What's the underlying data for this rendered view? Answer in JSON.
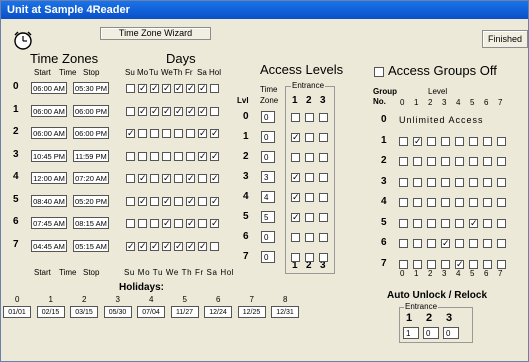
{
  "window": {
    "title": "Unit at Sample 4Reader"
  },
  "toolbar": {
    "wizard_label": "Time Zone Wizard",
    "finished_label": "Finished"
  },
  "timezones": {
    "heading": "Time Zones",
    "days_heading": "Days",
    "col_start": "Start",
    "col_time": "Time",
    "col_stop": "Stop",
    "day_labels": [
      "Su",
      "Mo",
      "Tu",
      "We",
      "Th",
      "Fr",
      "Sa",
      "Hol"
    ],
    "rows": [
      {
        "num": "0",
        "start": "06:00 AM",
        "stop": "05:30 PM",
        "days": [
          0,
          1,
          1,
          1,
          1,
          1,
          1,
          0
        ]
      },
      {
        "num": "1",
        "start": "06:00 AM",
        "stop": "06:00 PM",
        "days": [
          0,
          1,
          1,
          1,
          1,
          1,
          1,
          0
        ]
      },
      {
        "num": "2",
        "start": "06:00 AM",
        "stop": "06:00 PM",
        "days": [
          1,
          0,
          0,
          0,
          0,
          0,
          1,
          1
        ]
      },
      {
        "num": "3",
        "start": "10:45 PM",
        "stop": "11:59 PM",
        "days": [
          0,
          0,
          0,
          0,
          0,
          0,
          1,
          1
        ]
      },
      {
        "num": "4",
        "start": "12:00 AM",
        "stop": "07:20 AM",
        "days": [
          0,
          1,
          0,
          1,
          0,
          1,
          0,
          1
        ]
      },
      {
        "num": "5",
        "start": "08:40 AM",
        "stop": "05:20 PM",
        "days": [
          0,
          1,
          0,
          1,
          0,
          1,
          0,
          1
        ]
      },
      {
        "num": "6",
        "start": "07:45 AM",
        "stop": "08:15 AM",
        "days": [
          0,
          0,
          0,
          1,
          0,
          1,
          0,
          1
        ]
      },
      {
        "num": "7",
        "start": "04:45 AM",
        "stop": "05:15 AM",
        "days": [
          1,
          1,
          1,
          1,
          1,
          1,
          1,
          0
        ]
      }
    ],
    "footer_start": "Start",
    "footer_time": "Time",
    "footer_stop": "Stop",
    "footer_days": "Su Mo Tu We Th Fr Sa Hol"
  },
  "holidays": {
    "heading": "Holidays:",
    "indexes": [
      "0",
      "1",
      "2",
      "3",
      "4",
      "5",
      "6",
      "7",
      "8"
    ],
    "dates": [
      "01/01",
      "02/15",
      "03/15",
      "05/30",
      "07/04",
      "11/27",
      "12/24",
      "12/25",
      "12/31"
    ]
  },
  "access_levels": {
    "heading": "Access Levels",
    "time_zone_label_1": "Time",
    "time_zone_label_2": "Zone",
    "lvl_label": "Lvl",
    "entrance_label": "Entrance",
    "entrance_nums": [
      "1",
      "2",
      "3"
    ],
    "rows": [
      {
        "lvl": "0",
        "tz": "0",
        "ent": [
          0,
          0,
          0
        ]
      },
      {
        "lvl": "1",
        "tz": "0",
        "ent": [
          1,
          0,
          0
        ]
      },
      {
        "lvl": "2",
        "tz": "0",
        "ent": [
          0,
          0,
          0
        ]
      },
      {
        "lvl": "3",
        "tz": "3",
        "ent": [
          1,
          0,
          0
        ]
      },
      {
        "lvl": "4",
        "tz": "4",
        "ent": [
          1,
          0,
          0
        ]
      },
      {
        "lvl": "5",
        "tz": "5",
        "ent": [
          1,
          0,
          0
        ]
      },
      {
        "lvl": "6",
        "tz": "0",
        "ent": [
          0,
          0,
          0
        ]
      },
      {
        "lvl": "7",
        "tz": "0",
        "ent": [
          0,
          0,
          0
        ]
      }
    ]
  },
  "access_groups": {
    "toggle_label": "Access Groups Off",
    "group_label_1": "Group",
    "group_label_2": "No.",
    "level_label": "Level",
    "level_nums": [
      "0",
      "1",
      "2",
      "3",
      "4",
      "5",
      "6",
      "7"
    ],
    "row0_text": "Unlimited  Access",
    "rows": [
      {
        "num": "0"
      },
      {
        "num": "1",
        "cells": [
          0,
          1,
          0,
          0,
          0,
          0,
          0,
          0
        ]
      },
      {
        "num": "2",
        "cells": [
          0,
          0,
          0,
          0,
          0,
          0,
          0,
          0
        ]
      },
      {
        "num": "3",
        "cells": [
          0,
          0,
          0,
          0,
          0,
          0,
          0,
          0
        ]
      },
      {
        "num": "4",
        "cells": [
          0,
          0,
          0,
          0,
          0,
          0,
          0,
          0
        ]
      },
      {
        "num": "5",
        "cells": [
          0,
          0,
          0,
          0,
          0,
          1,
          0,
          0
        ]
      },
      {
        "num": "6",
        "cells": [
          0,
          0,
          0,
          1,
          0,
          0,
          0,
          0
        ]
      },
      {
        "num": "7",
        "cells": [
          0,
          0,
          0,
          0,
          1,
          0,
          0,
          0
        ]
      }
    ]
  },
  "auto_unlock": {
    "heading": "Auto Unlock / Relock",
    "entrance_label": "Entrance",
    "nums": [
      "1",
      "2",
      "3"
    ],
    "values": [
      "1",
      "0",
      "0"
    ]
  }
}
